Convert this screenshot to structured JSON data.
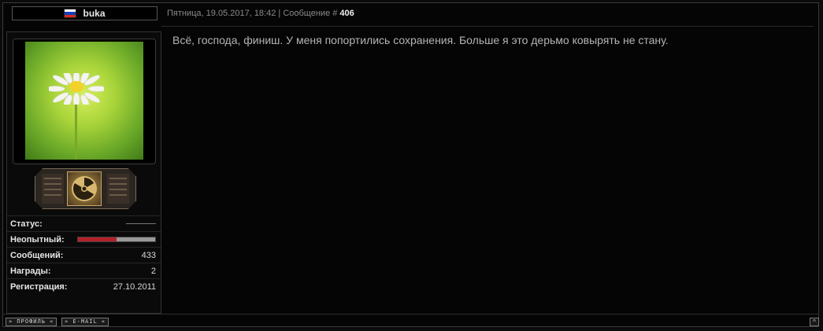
{
  "header": {
    "username": "buka",
    "date": "Пятница, 19.05.2017, 18:42",
    "separator": " | ",
    "message_label": "Сообщение # ",
    "message_number": "406",
    "flag_colors": [
      "#ffffff",
      "#1a3fb8",
      "#d52b1e"
    ]
  },
  "sidebar": {
    "avatar_icon": "daisy-flower-image",
    "badge_icon": "radiation-badge",
    "stats": [
      {
        "label": "Статус:",
        "value": ""
      },
      {
        "label": "Неопытный:",
        "value": "",
        "rank_progress": 0.5
      },
      {
        "label": "Сообщений:",
        "value": "433"
      },
      {
        "label": "Награды:",
        "value": "2"
      },
      {
        "label": "Регистрация:",
        "value": "27.10.2011"
      }
    ]
  },
  "message": {
    "text": "Всё, господа, финиш. У меня попортились сохранения. Больше я это дерьмо ковырять не стану."
  },
  "footer": {
    "profile_label": "» ПРОФИЛЬ «",
    "email_label": "» E-MAIL «",
    "up_label": "^"
  }
}
